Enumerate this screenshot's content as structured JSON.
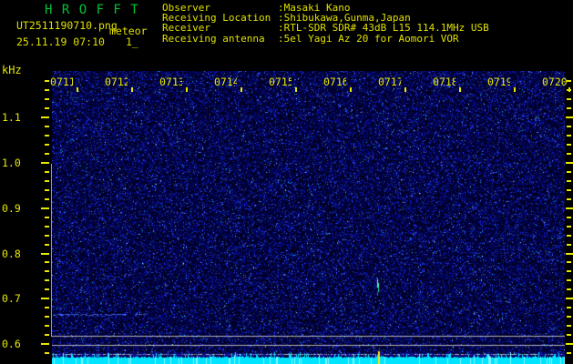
{
  "header": {
    "title": "H R O F F T",
    "filename": "UT2511190710.png",
    "mode": "meteor",
    "datetime": "25.11.19 07:10",
    "counter": "1_",
    "info": [
      {
        "label": "Observer",
        "value": ":Masaki Kano"
      },
      {
        "label": "Receiving Location",
        "value": ":Shibukawa,Gunma,Japan"
      },
      {
        "label": "Receiver",
        "value": ":RTL-SDR SDR# 43dB L15 114.1MHz USB"
      },
      {
        "label": "Receiving antenna",
        "value": ":5el Yagi Az 20 for Aomori VOR"
      }
    ]
  },
  "chart_data": {
    "type": "heatmap",
    "subtype": "meteor-radio-spectrogram",
    "title": "H R O F F T",
    "ylabel": "kHz",
    "y_tick_labels": [
      "1.1",
      "1.0",
      "0.9",
      "0.8",
      "0.7",
      "0.6"
    ],
    "y_range_khz": [
      0.58,
      1.2
    ],
    "x_tick_labels": [
      "0711",
      "0712",
      "0713",
      "0714",
      "0715",
      "0716",
      "0717",
      "0718",
      "0719",
      "0720"
    ],
    "x_axis": "time UT, one label per minute",
    "background_content": "random dark-blue receiver noise, no discrete spectral data",
    "grid": "three grey horizontal reference lines near the 0.6 kHz bottom band",
    "legend": "none",
    "bottom_strip": "cyan signal-level meter along bottom edge",
    "annotations": [
      {
        "type": "meteor-echo",
        "time_ut": "~0716.5",
        "freq_khz": 0.72
      },
      {
        "type": "echo-marker-tick",
        "time_ut": "~0716.5",
        "location": "signal-level strip"
      }
    ]
  },
  "colors": {
    "background": "#000000",
    "title_green": "#00c434",
    "text_yellow": "#e0e000",
    "axis_yellow": "#e8e800",
    "grid_grey": "#b4b4b4",
    "signal_cyan": "#00e4ff",
    "marker_yellow": "#ffe400",
    "noise_blue": "#0000c8",
    "echo_green": "#49f2b6"
  }
}
